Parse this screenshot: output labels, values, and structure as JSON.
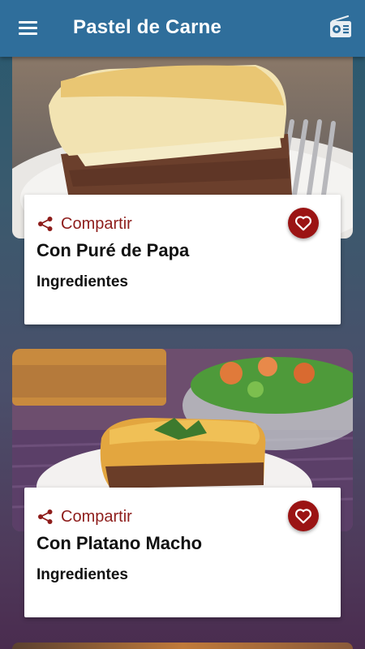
{
  "app": {
    "title": "Pastel de Carne",
    "menu_icon": "hamburger-menu-icon",
    "radio_icon": "radio-icon",
    "primary_color": "#2f6e9b",
    "accent_color": "#9b1414",
    "share_color": "#8e1d1b"
  },
  "recipes": [
    {
      "share_label": "Compartir",
      "share_icon": "share-icon",
      "favorite_icon": "heart-icon",
      "name": "Con Puré de Papa",
      "ingredients_label": "Ingredientes"
    },
    {
      "share_label": "Compartir",
      "share_icon": "share-icon",
      "favorite_icon": "heart-icon",
      "name": "Con Platano Macho",
      "ingredients_label": "Ingredientes"
    }
  ]
}
